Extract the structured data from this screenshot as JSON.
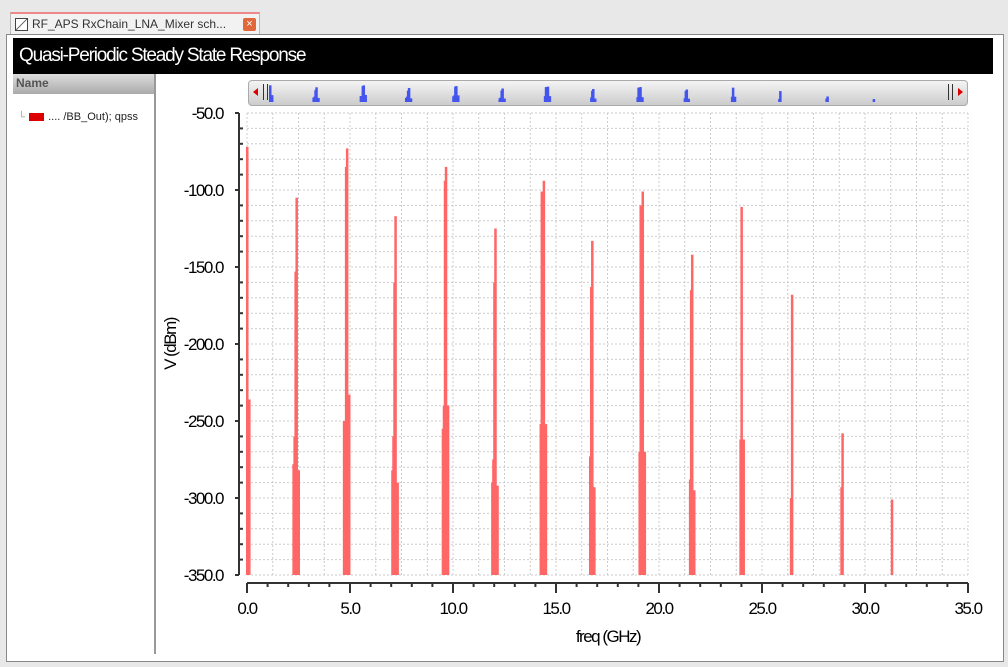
{
  "tab": {
    "title": "RF_APS RxChain_LNA_Mixer sch...",
    "close": "×"
  },
  "header": {
    "title": "Quasi-Periodic Steady State Response"
  },
  "legend_panel": {
    "header": "Name",
    "items": [
      {
        "label": ".... /BB_Out); qpss",
        "color": "#dd0000"
      }
    ]
  },
  "colors": {
    "trace": "#ff6666",
    "scroll_marks": "#4455ee"
  },
  "chart_data": {
    "type": "bar",
    "title": "Quasi-Periodic Steady State Response",
    "xlabel": "freq (GHz)",
    "ylabel": "V (dBm)",
    "xlim": [
      0,
      35
    ],
    "ylim": [
      -350,
      -50
    ],
    "xticks": [
      "0.0",
      "5.0",
      "10.0",
      "15.0",
      "20.0",
      "25.0",
      "30.0",
      "35.0"
    ],
    "yticks": [
      "-50.0",
      "-100.0",
      "-150.0",
      "-200.0",
      "-250.0",
      "-300.0",
      "-350.0"
    ],
    "grid": true,
    "series": [
      {
        "name": ".... /BB_Out); qpss",
        "points": [
          [
            0.0,
            -72
          ],
          [
            0.1,
            -236
          ],
          [
            2.25,
            -278
          ],
          [
            2.3,
            -260
          ],
          [
            2.35,
            -153
          ],
          [
            2.4,
            -105
          ],
          [
            2.5,
            -282
          ],
          [
            4.7,
            -250
          ],
          [
            4.8,
            -85
          ],
          [
            4.85,
            -73
          ],
          [
            4.95,
            -233
          ],
          [
            7.05,
            -282
          ],
          [
            7.1,
            -260
          ],
          [
            7.15,
            -160
          ],
          [
            7.2,
            -117
          ],
          [
            7.3,
            -290
          ],
          [
            9.5,
            -255
          ],
          [
            9.55,
            -240
          ],
          [
            9.6,
            -94
          ],
          [
            9.65,
            -85
          ],
          [
            9.75,
            -240
          ],
          [
            11.9,
            -290
          ],
          [
            11.95,
            -275
          ],
          [
            12.0,
            -160
          ],
          [
            12.05,
            -125
          ],
          [
            12.15,
            -292
          ],
          [
            14.25,
            -252
          ],
          [
            14.3,
            -101
          ],
          [
            14.4,
            -94
          ],
          [
            14.5,
            -252
          ],
          [
            16.65,
            -273
          ],
          [
            16.7,
            -163
          ],
          [
            16.75,
            -133
          ],
          [
            16.85,
            -293
          ],
          [
            19.05,
            -270
          ],
          [
            19.1,
            -110
          ],
          [
            19.2,
            -101
          ],
          [
            19.3,
            -270
          ],
          [
            21.5,
            -288
          ],
          [
            21.55,
            -165
          ],
          [
            21.6,
            -142
          ],
          [
            21.7,
            -295
          ],
          [
            23.95,
            -262
          ],
          [
            24.0,
            -111
          ],
          [
            24.1,
            -262
          ],
          [
            26.4,
            -300
          ],
          [
            26.45,
            -168
          ],
          [
            28.85,
            -293
          ],
          [
            28.9,
            -258
          ],
          [
            31.3,
            -301
          ]
        ]
      }
    ]
  }
}
